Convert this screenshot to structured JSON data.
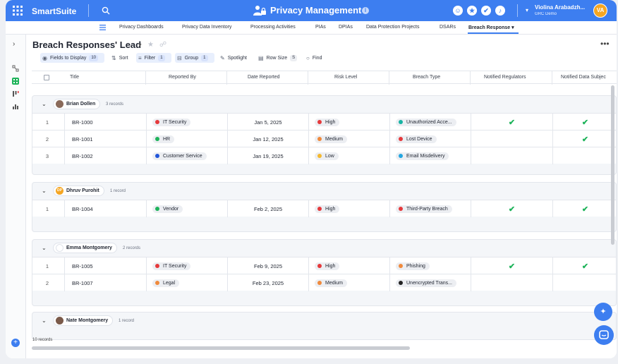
{
  "topbar": {
    "brand": "SmartSuite",
    "app_title": "Privacy Management",
    "info_icon": "i",
    "user_name": "Violina Arabadzh...",
    "user_org": "GRC Demo",
    "user_initials": "VA",
    "icons": [
      "users-icon",
      "star-icon",
      "check-icon",
      "bell-icon"
    ]
  },
  "nav": {
    "tabs": [
      {
        "label": "Privacy Dashboards"
      },
      {
        "label": "Privacy Data Inventory"
      },
      {
        "label": "Processing Activities"
      },
      {
        "label": "PIAs"
      },
      {
        "label": "DPIAs"
      },
      {
        "label": "Data Protection Projects"
      },
      {
        "label": "DSARs"
      },
      {
        "label": "Breach Response"
      }
    ],
    "active_tab": "Breach Response"
  },
  "view": {
    "title": "Breach Responses' Lead",
    "toolbar": {
      "fields_label": "Fields to Display",
      "fields_count": "10",
      "sort_label": "Sort",
      "filter_label": "Filter",
      "filter_count": "1",
      "group_label": "Group",
      "group_count": "1",
      "spotlight_label": "Spotlight",
      "rowsize_label": "Row Size",
      "rowsize_value": "S",
      "find_label": "Find"
    }
  },
  "columns": [
    "Title",
    "Reported By",
    "Date Reported",
    "Risk Level",
    "Breach Type",
    "Notified Regulators",
    "Notified Data Subjec"
  ],
  "groups": [
    {
      "name": "Brian Dollen",
      "count": "3 records",
      "initials": "",
      "rows": [
        {
          "num": "1",
          "title": "BR-1000",
          "reported_by": "IT Security",
          "date": "Jan 5, 2025",
          "risk": "High",
          "type": "Unauthorized Acce...",
          "regulators": "✔",
          "subjects": "✔"
        },
        {
          "num": "2",
          "title": "BR-1001",
          "reported_by": "HR",
          "date": "Jan 12, 2025",
          "risk": "Medium",
          "type": "Lost Device",
          "regulators": "",
          "subjects": "✔"
        },
        {
          "num": "3",
          "title": "BR-1002",
          "reported_by": "Customer Service",
          "date": "Jan 19, 2025",
          "risk": "Low",
          "type": "Email Misdelivery",
          "regulators": "",
          "subjects": ""
        }
      ]
    },
    {
      "name": "Dhruv Purohit",
      "count": "1 record",
      "initials": "DP",
      "rows": [
        {
          "num": "1",
          "title": "BR-1004",
          "reported_by": "Vendor",
          "date": "Feb 2, 2025",
          "risk": "High",
          "type": "Third-Party Breach",
          "regulators": "✔",
          "subjects": "✔"
        }
      ]
    },
    {
      "name": "Emma Montgomery",
      "count": "2 records",
      "initials": "",
      "rows": [
        {
          "num": "1",
          "title": "BR-1005",
          "reported_by": "IT Security",
          "date": "Feb 9, 2025",
          "risk": "High",
          "type": "Phishing",
          "regulators": "✔",
          "subjects": "✔"
        },
        {
          "num": "2",
          "title": "BR-1007",
          "reported_by": "Legal",
          "date": "Feb 23, 2025",
          "risk": "Medium",
          "type": "Unencrypted Trans...",
          "regulators": "",
          "subjects": ""
        }
      ]
    },
    {
      "name": "Nate Montgomery",
      "count": "1 record",
      "initials": "",
      "rows": []
    }
  ],
  "footer": {
    "record_count": "10 records"
  },
  "colors": {
    "accent": "#3d7ef0",
    "reported_by": {
      "IT Security": "#e5393b",
      "HR": "#1eb35a",
      "Customer Service": "#2155d9",
      "Vendor": "#1eb35a",
      "Legal": "#f08a3c"
    },
    "risk": {
      "High": "#e5393b",
      "Medium": "#f08a3c",
      "Low": "#f5b82e"
    },
    "type": {
      "Unauthorized Acce...": "#17b3a3",
      "Lost Device": "#e5393b",
      "Email Misdelivery": "#23a6e0",
      "Third-Party Breach": "#e5393b",
      "Phishing": "#f08a3c",
      "Unencrypted Trans...": "#222222"
    }
  }
}
